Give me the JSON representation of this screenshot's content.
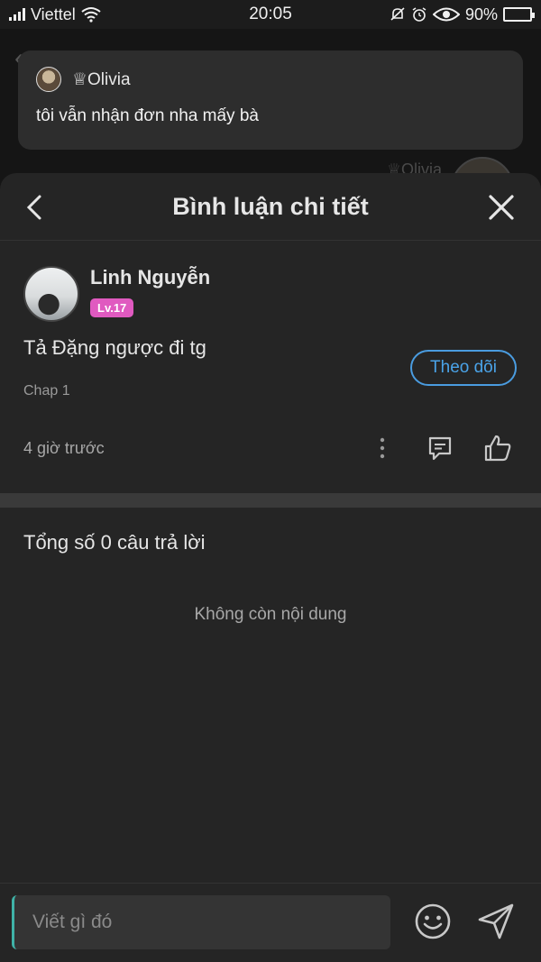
{
  "status_bar": {
    "carrier": "Viettel",
    "time": "20:05",
    "battery": "90%",
    "battery_level": 0.9
  },
  "notification": {
    "sender": "♕Olivia",
    "message": "tôi vẫn nhận đơn nha mấy bà"
  },
  "background": {
    "reply_name": "♕Olivia"
  },
  "sheet": {
    "title": "Bình luận chi tiết"
  },
  "comment": {
    "user_name": "Linh Nguyễn",
    "level": "Lv.17",
    "follow_label": "Theo dõi",
    "text": "Tả Đặng ngược đi tg",
    "chapter": "Chap 1",
    "time": "4 giờ trước"
  },
  "replies": {
    "total_label": "Tổng số 0 câu trả lời",
    "empty_label": "Không còn nội dung"
  },
  "input": {
    "placeholder": "Viết gì đó"
  },
  "colors": {
    "accent": "#4aa3e8",
    "level_badge": "#e05ac0",
    "background": "#252525"
  }
}
